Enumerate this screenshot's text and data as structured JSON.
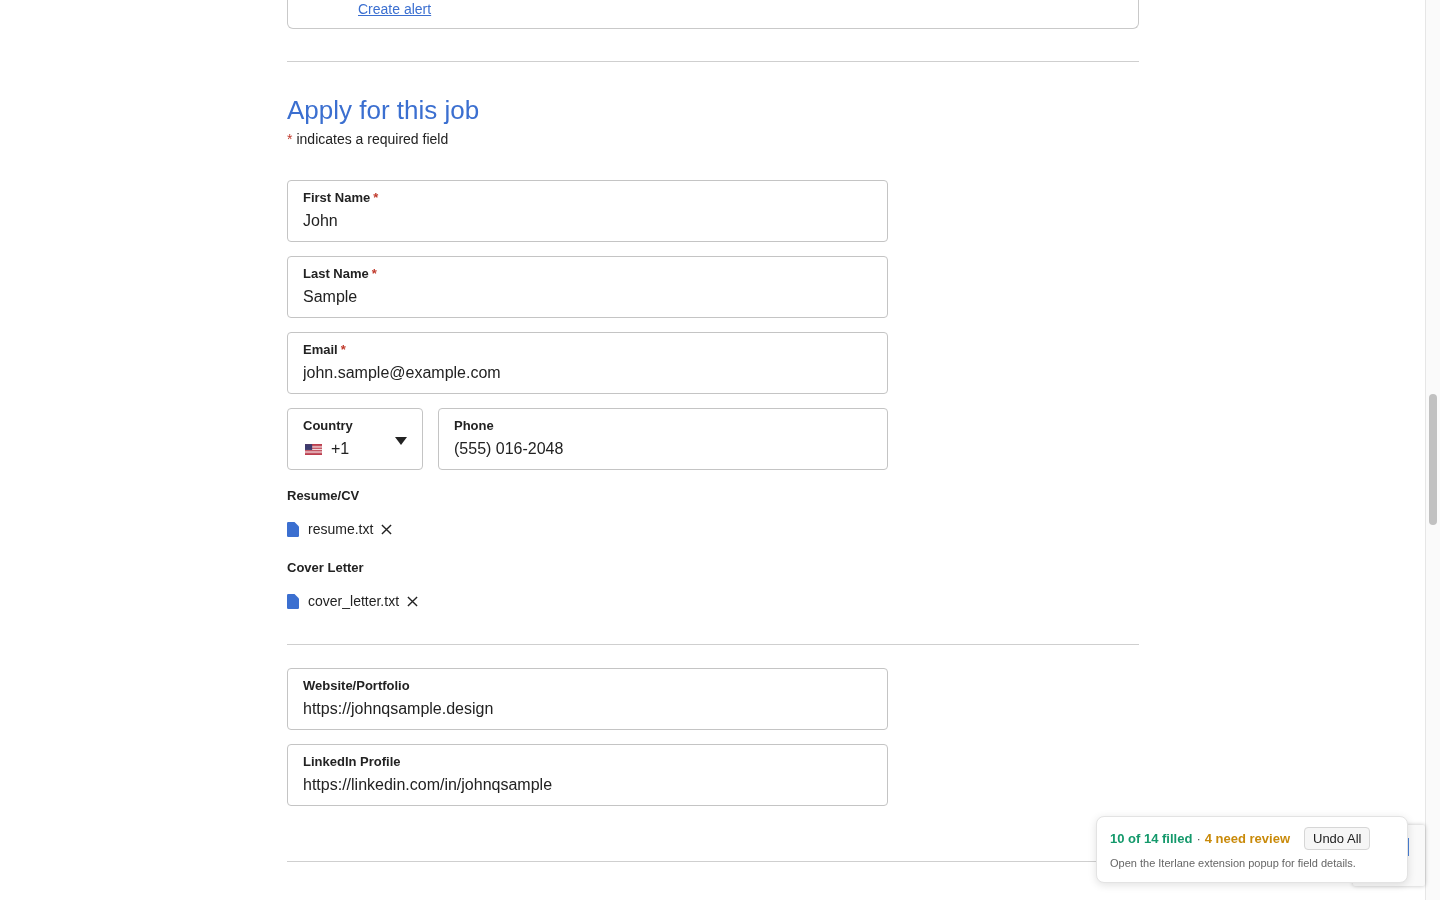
{
  "alert_card": {
    "link": "Create alert"
  },
  "apply_section": {
    "title": "Apply for this job",
    "required_mark": "*",
    "required_note": "indicates a required field"
  },
  "fields": [
    {
      "kind": "text",
      "label": "First Name",
      "required_mark": "*",
      "value": "John"
    },
    {
      "kind": "text",
      "label": "Last Name",
      "required_mark": "*",
      "value": "Sample"
    },
    {
      "kind": "text",
      "label": "Email",
      "required_mark": "*",
      "value": "john.sample@example.com"
    },
    {
      "kind": "phone",
      "country": {
        "label": "Country",
        "value": "+1"
      },
      "phone": {
        "label": "Phone",
        "value": "(555) 016-2048"
      }
    }
  ],
  "attachments": [
    {
      "label": "Resume/CV",
      "file": "resume.txt"
    },
    {
      "label": "Cover Letter",
      "file": "cover_letter.txt"
    }
  ],
  "link_fields": [
    {
      "kind": "text",
      "label": "Website/Portfolio",
      "value": "https://johnqsample.design"
    },
    {
      "kind": "text",
      "label": "LinkedIn Profile",
      "value": "https://linkedin.com/in/johnqsample"
    }
  ],
  "autofill_toast": {
    "filled": "10 of 14 filled",
    "separator": "·",
    "review": "4 need review",
    "button": "Undo All",
    "hint": "Open the Iterlane extension popup for field details."
  }
}
